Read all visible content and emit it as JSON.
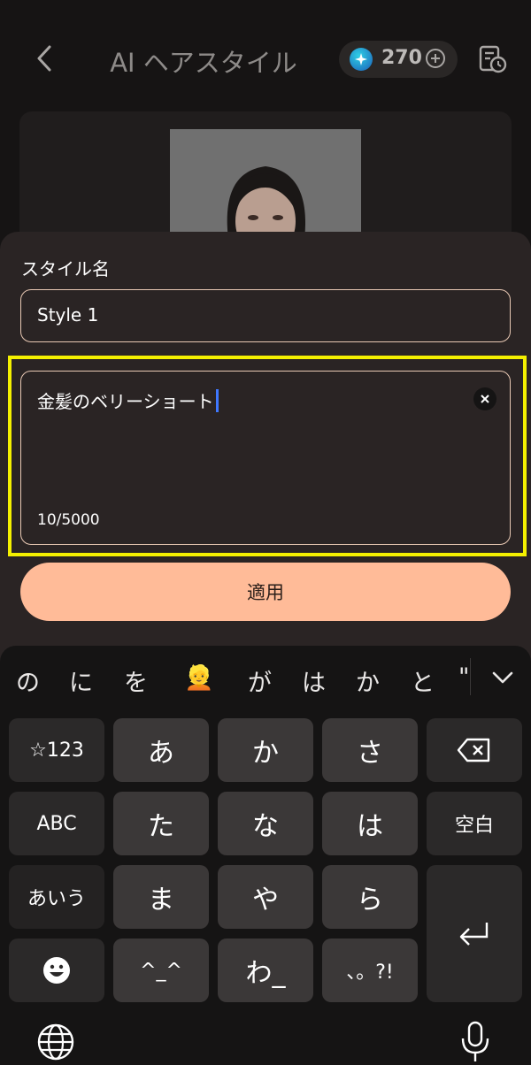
{
  "header": {
    "title": "AI ヘアスタイル",
    "credits": "270"
  },
  "style_name": {
    "label": "スタイル名",
    "value": "Style 1"
  },
  "prompt": {
    "value": "金髪のベリーショート",
    "counter": "10/5000"
  },
  "apply_label": "適用",
  "keyboard": {
    "suggestions": [
      "の",
      "に",
      "を",
      "👱",
      "が",
      "は",
      "か",
      "と",
      "\""
    ],
    "keys": {
      "symbols": "☆123",
      "abc": "ABC",
      "aiu": "あいう",
      "a": "あ",
      "ka": "か",
      "sa": "さ",
      "ta": "た",
      "na": "な",
      "ha": "は",
      "ma": "ま",
      "ya": "や",
      "ra": "ら",
      "kaomoji": "^_^",
      "wa": "わ_",
      "punct": "、。?!",
      "space": "空白"
    }
  },
  "colors": {
    "accent": "#ffbb98",
    "highlight": "#f4f000",
    "field_border": "#e9c9b4",
    "caret": "#3f78ff"
  }
}
